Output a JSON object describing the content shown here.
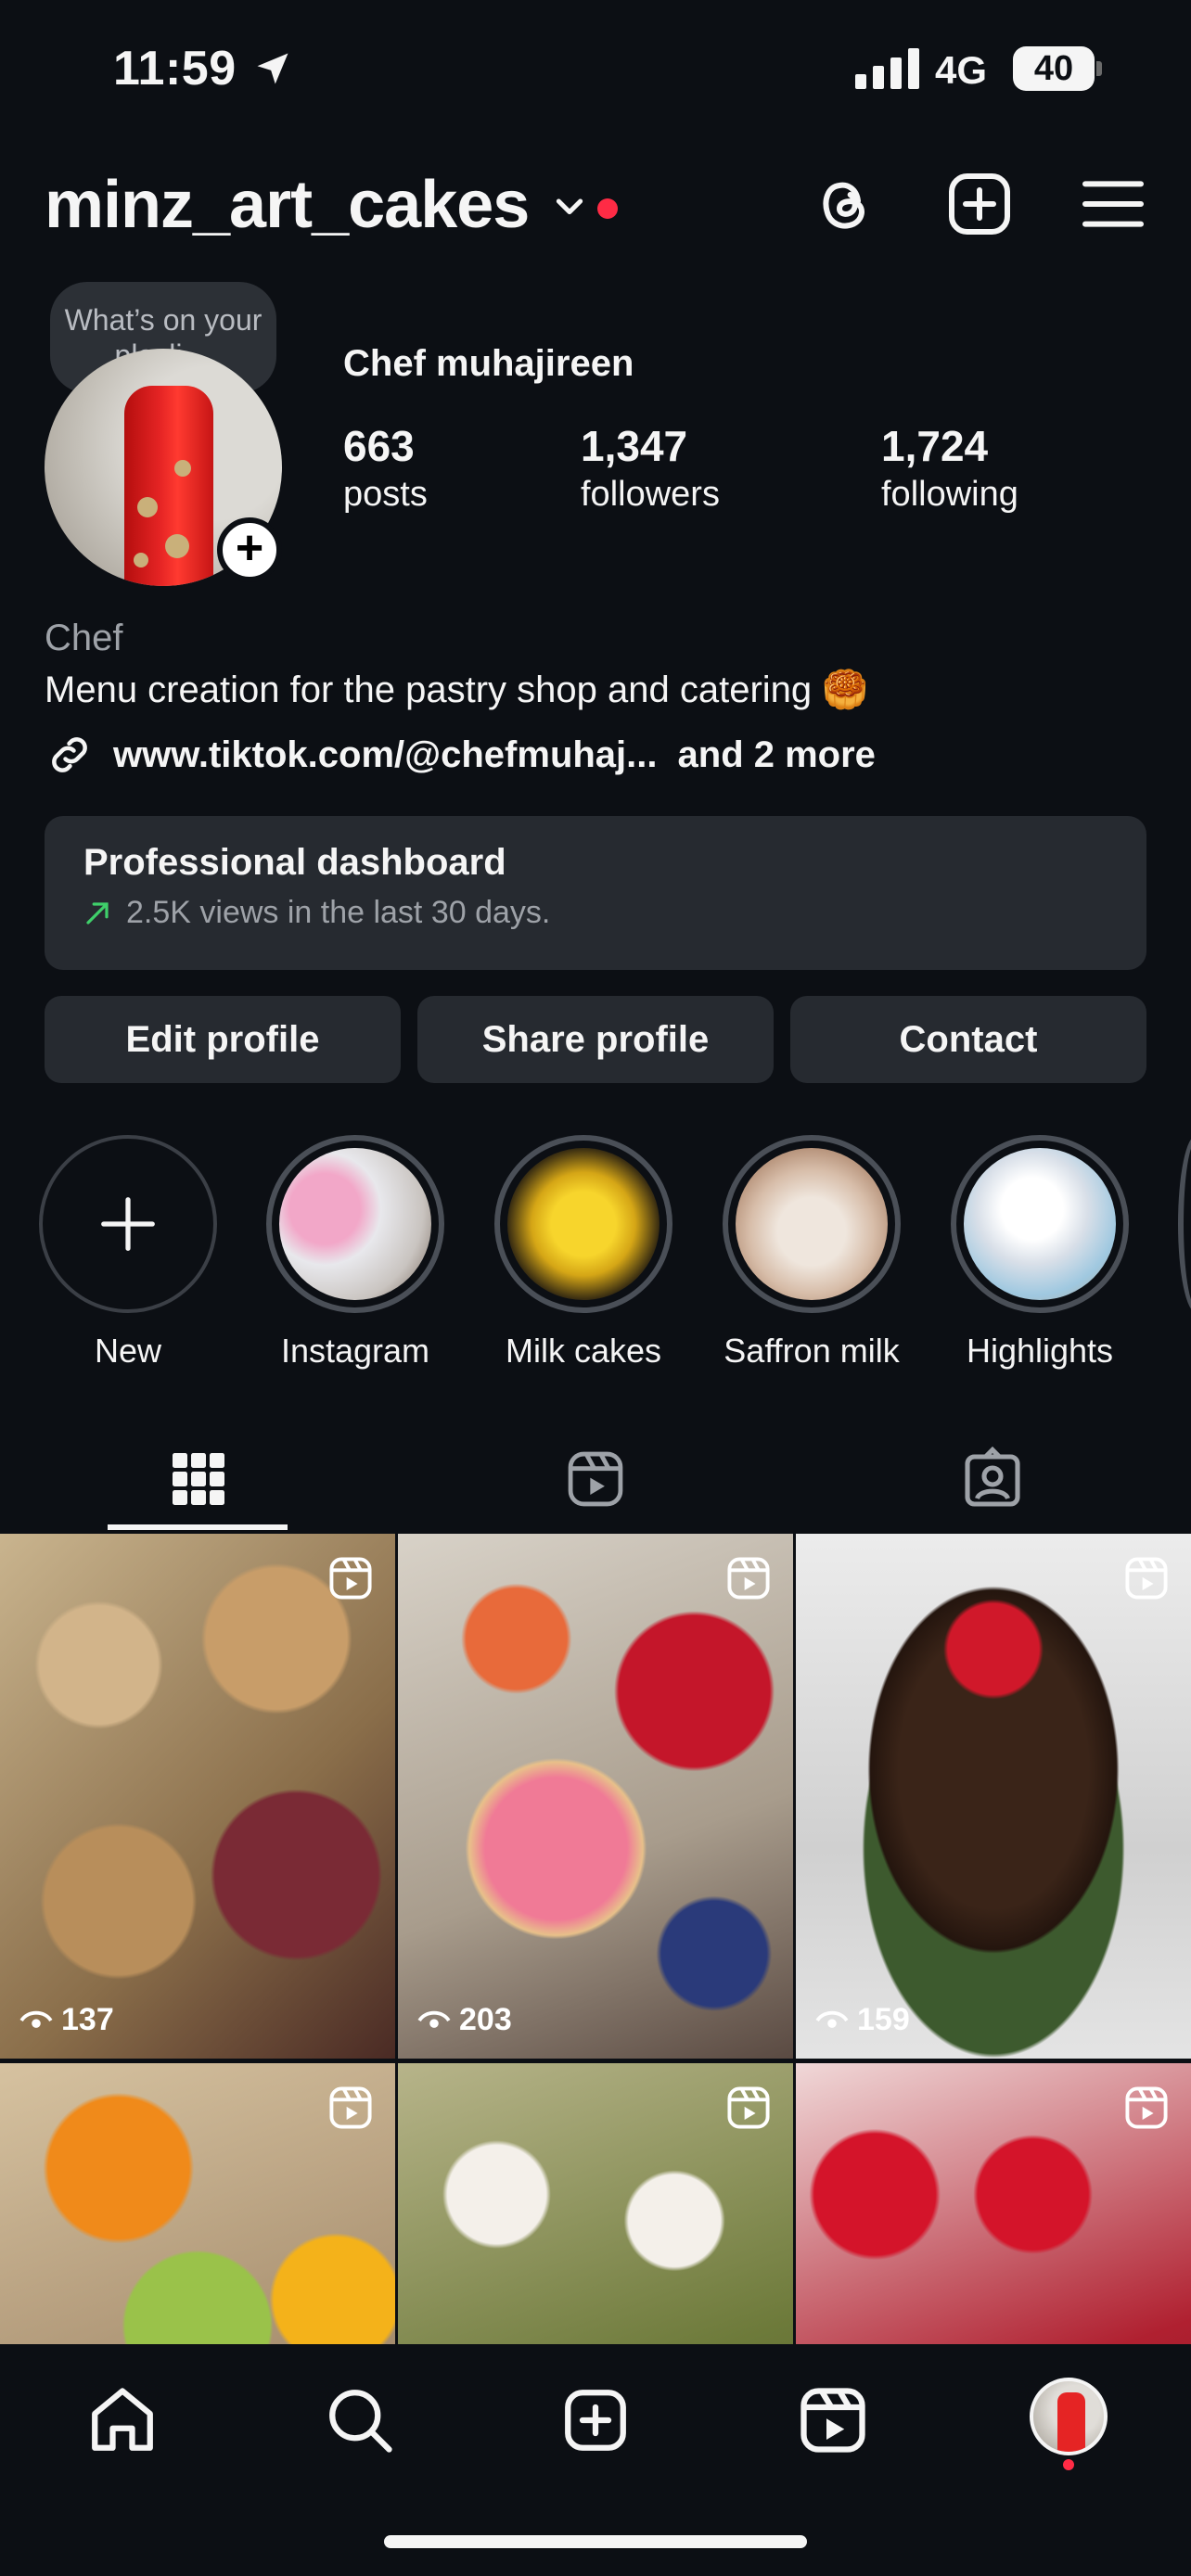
{
  "status_bar": {
    "time": "11:59",
    "network": "4G",
    "battery": "40"
  },
  "header": {
    "username": "minz_art_cakes"
  },
  "profile": {
    "note": "What’s on your playli…",
    "display_name": "Chef muhajireen",
    "stats": [
      {
        "value": "663",
        "label": "posts"
      },
      {
        "value": "1,347",
        "label": "followers"
      },
      {
        "value": "1,724",
        "label": "following"
      }
    ],
    "category": "Chef",
    "bio": "Menu creation for the pastry shop and catering 🥮",
    "link": "www.tiktok.com/@chefmuhaj...",
    "link_more": "and 2 more"
  },
  "dashboard": {
    "title": "Professional dashboard",
    "subtitle": "2.5K views in the last 30 days.",
    "accent": "#3fcf6a"
  },
  "buttons": {
    "edit": "Edit profile",
    "share": "Share profile",
    "contact": "Contact"
  },
  "highlights": [
    {
      "label": "New",
      "icon": "plus-icon"
    },
    {
      "label": "Instagram"
    },
    {
      "label": "Milk cakes"
    },
    {
      "label": "Saffron milk"
    },
    {
      "label": "Highlights"
    }
  ],
  "tabs": [
    {
      "name": "posts-grid",
      "icon": "grid-icon",
      "active": true
    },
    {
      "name": "reels",
      "icon": "reels-icon",
      "active": false
    },
    {
      "name": "tagged",
      "icon": "tagged-person-icon",
      "active": false
    }
  ],
  "posts": [
    {
      "views": "137",
      "is_reel": true
    },
    {
      "views": "203",
      "is_reel": true
    },
    {
      "views": "159",
      "is_reel": true
    },
    {
      "views": "",
      "is_reel": true
    },
    {
      "views": "",
      "is_reel": true
    },
    {
      "views": "",
      "is_reel": true
    }
  ],
  "bottom_nav": [
    "home-icon",
    "search-icon",
    "create-icon",
    "reels-icon",
    "profile-avatar"
  ],
  "colors": {
    "background": "#0c0f14",
    "surface": "#262a30",
    "notification": "#ff2b45"
  }
}
